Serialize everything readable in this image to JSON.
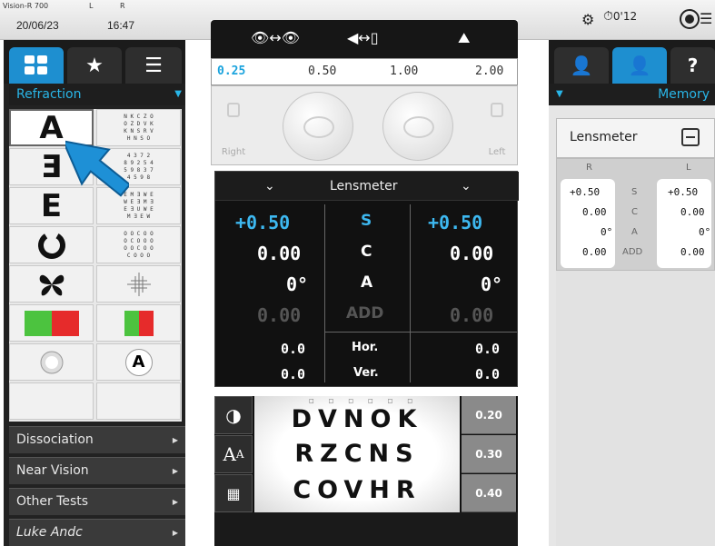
{
  "status_bar": {
    "system": "Vision-R 700",
    "l": "L",
    "r": "R",
    "date": "20/06/23",
    "time": "16:47",
    "timer": "0'12"
  },
  "left_panel": {
    "selector_label": "Refraction",
    "charts": [
      {
        "symbol": "A",
        "preview": [
          "N K C Z O",
          "O Z D V K",
          "K N S R V",
          "H N S O",
          "D O K"
        ]
      },
      {
        "symbol": "Ǝ",
        "preview": [
          "4 3 7 2",
          "8 9 2 5 4",
          "5 9 8 3 7",
          "4 5 9 8",
          "3 5 2"
        ]
      },
      {
        "symbol": "E",
        "preview": [
          "E M Ǝ W E",
          "W E Ǝ M Ǝ",
          "E Ǝ U W E",
          "M Ǝ E W",
          "E M Ǝ"
        ]
      },
      {
        "symbol": "O",
        "preview": [
          "O O C O O",
          "O C O O O",
          "O O C O O",
          "C O O O",
          "O O C"
        ]
      },
      {
        "symbol": "✕",
        "preview": []
      },
      {
        "symbol": "",
        "preview": []
      },
      {
        "symbol": "",
        "preview": []
      },
      {
        "symbol": "A",
        "preview": []
      }
    ],
    "menu": [
      {
        "label": "Dissociation"
      },
      {
        "label": "Near Vision"
      },
      {
        "label": "Other Tests"
      },
      {
        "label": "Luke Andc"
      }
    ]
  },
  "distance_control": {
    "values": [
      "0.25",
      "0.50",
      "1.00",
      "2.00"
    ],
    "active_value": "0.25",
    "right_label": "Right",
    "left_label": "Left"
  },
  "lensmeter": {
    "title": "Lensmeter",
    "rows": [
      {
        "right": "+0.50",
        "label": "S",
        "left": "+0.50"
      },
      {
        "right": "0.00",
        "label": "C",
        "left": "0.00"
      },
      {
        "right": "0°",
        "label": "A",
        "left": "0°"
      },
      {
        "right": "0.00",
        "label": "ADD",
        "left": "0.00"
      },
      {
        "right": "0.0",
        "label": "Hor.",
        "left": "0.0"
      },
      {
        "right": "0.0",
        "label": "Ver.",
        "left": "0.0"
      }
    ]
  },
  "optotype_chart": {
    "lines": [
      "DVNOK",
      "RZCNS",
      "COVHR"
    ],
    "acuity": [
      "0.20",
      "0.30",
      "0.40"
    ]
  },
  "right_panel": {
    "selector_label": "Memory",
    "memory_title": "Lensmeter",
    "col_r": "R",
    "col_l": "L",
    "rows": [
      {
        "right": "+0.50",
        "label": "S",
        "left": "+0.50"
      },
      {
        "right": "0.00",
        "label": "C",
        "left": "0.00"
      },
      {
        "right": "0°",
        "label": "A",
        "left": "0°"
      },
      {
        "right": "0.00",
        "label": "ADD",
        "left": "0.00"
      }
    ]
  },
  "colors": {
    "accent_blue": "#29b6e8",
    "dark_panel": "#1b1b1b"
  }
}
